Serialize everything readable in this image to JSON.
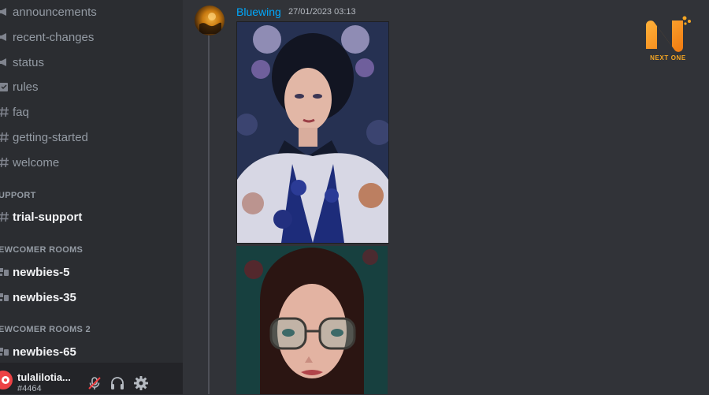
{
  "sidebar": {
    "channels_top": [
      {
        "name": "announcements",
        "icon": "announcement-icon"
      },
      {
        "name": "recent-changes",
        "icon": "announcement-icon"
      },
      {
        "name": "status",
        "icon": "announcement-icon"
      },
      {
        "name": "rules",
        "icon": "rules-icon"
      },
      {
        "name": "faq",
        "icon": "hashtag-icon"
      },
      {
        "name": "getting-started",
        "icon": "hashtag-icon"
      },
      {
        "name": "welcome",
        "icon": "hashtag-icon"
      }
    ],
    "category_support": "UPPORT",
    "support_channels": [
      {
        "name": "trial-support",
        "icon": "hashtag-icon"
      }
    ],
    "category_newcomer": "EWCOMER ROOMS",
    "newcomer_channels": [
      {
        "name": "newbies-5",
        "icon": "thread-channel-icon"
      },
      {
        "name": "newbies-35",
        "icon": "thread-channel-icon"
      }
    ],
    "category_newcomer_2": "EWCOMER ROOMS 2",
    "newcomer_2_channels": [
      {
        "name": "newbies-65",
        "icon": "thread-channel-icon"
      }
    ]
  },
  "user_panel": {
    "username": "tulalilotia...",
    "tag": "#4464",
    "icons": [
      "muted-mic-icon",
      "headphones-icon",
      "gear-icon"
    ]
  },
  "message": {
    "author": "Bluewing",
    "timestamp": "27/01/2023 03:13"
  },
  "logo": {
    "text": "NEXT ONE"
  },
  "colors": {
    "background": "#313338",
    "sidebar": "#2b2d31",
    "author": "#00a8fc",
    "logo": "#f5a623"
  }
}
